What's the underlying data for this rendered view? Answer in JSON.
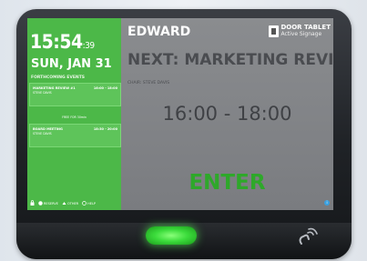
{
  "colors": {
    "left_panel": "#4cb848",
    "enter_text": "#2ea82a",
    "device": "#1f2226",
    "led": "#3cdc3c"
  },
  "left": {
    "clock_hm": "15:54",
    "clock_s": ":39",
    "date": "SUN, JAN 31",
    "forthcoming_label": "FORTHCOMING EVENTS",
    "events": [
      {
        "title": "MARKETING REVIEW #1",
        "time": "16:00 - 18:00",
        "sub": "STEVE DAVIS"
      },
      {
        "title": "BOARD MEETING",
        "time": "18:30 - 20:00",
        "sub": "STEVE DAVIS"
      }
    ],
    "free_slot": "FREE FOR 30min",
    "actions": [
      {
        "icon": "lock-icon",
        "label": ""
      },
      {
        "icon": "reserve-icon",
        "label": "RESERVE"
      },
      {
        "icon": "other-icon",
        "label": "OTHER"
      },
      {
        "icon": "help-icon",
        "label": "HELP"
      }
    ]
  },
  "right": {
    "room": "EDWARD",
    "logo_main": "DOOR TABLET",
    "logo_sub": "Active Signage",
    "next_meeting": "NEXT: MARKETING REVIEW",
    "chair": "CHAIR: STEVE DAVIS",
    "time_range": "16:00 - 18:00",
    "enter_label": "ENTER",
    "info_icon": "i"
  }
}
